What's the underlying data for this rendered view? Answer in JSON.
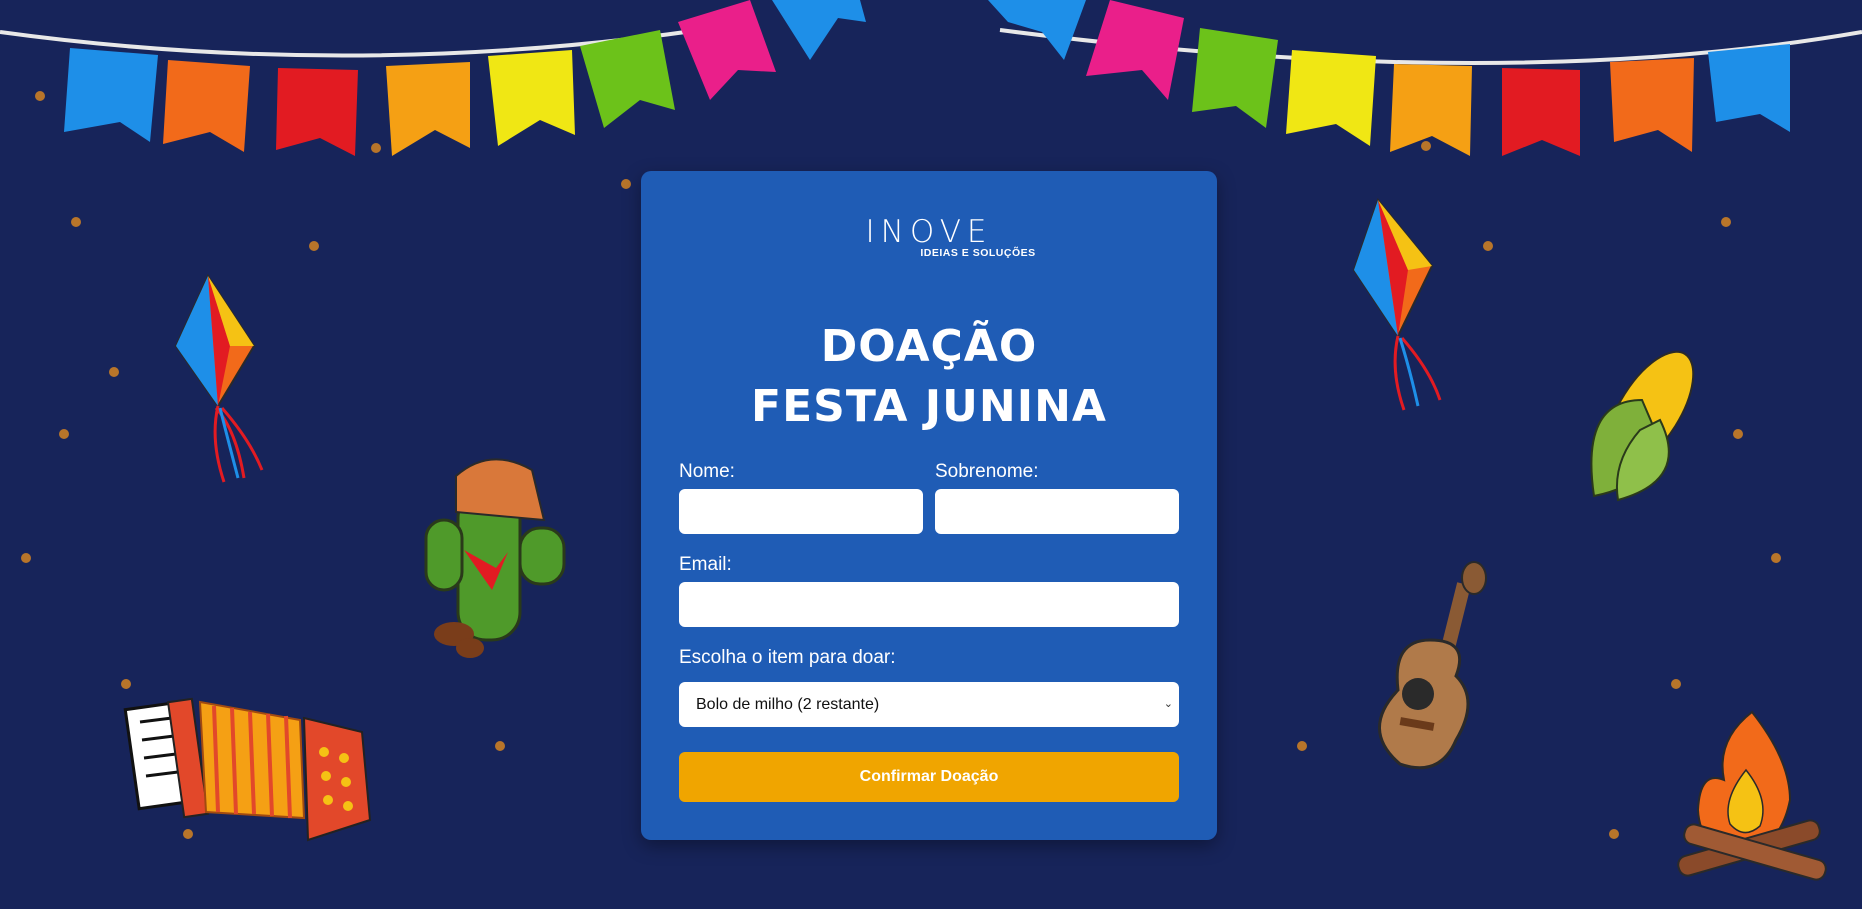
{
  "logo": {
    "word": "INOVE",
    "tagline": "IDEIAS E SOLUÇÕES"
  },
  "title": {
    "line1": "Doação",
    "line2": "Festa Junina"
  },
  "form": {
    "first_name_label": "Nome:",
    "last_name_label": "Sobrenome:",
    "email_label": "Email:",
    "item_label": "Escolha o item para doar:",
    "item_selected": "Bolo de milho (2 restante)",
    "submit_label": "Confirmar Doação",
    "first_name_value": "",
    "last_name_value": "",
    "email_value": ""
  },
  "colors": {
    "background": "#17245a",
    "card": "#1f5cb5",
    "button": "#f0a500",
    "field": "#ffffff"
  },
  "decorations": [
    "bunting-flags",
    "paper-lantern",
    "cactus",
    "accordion",
    "corn",
    "guitar",
    "bonfire",
    "confetti-dots"
  ]
}
